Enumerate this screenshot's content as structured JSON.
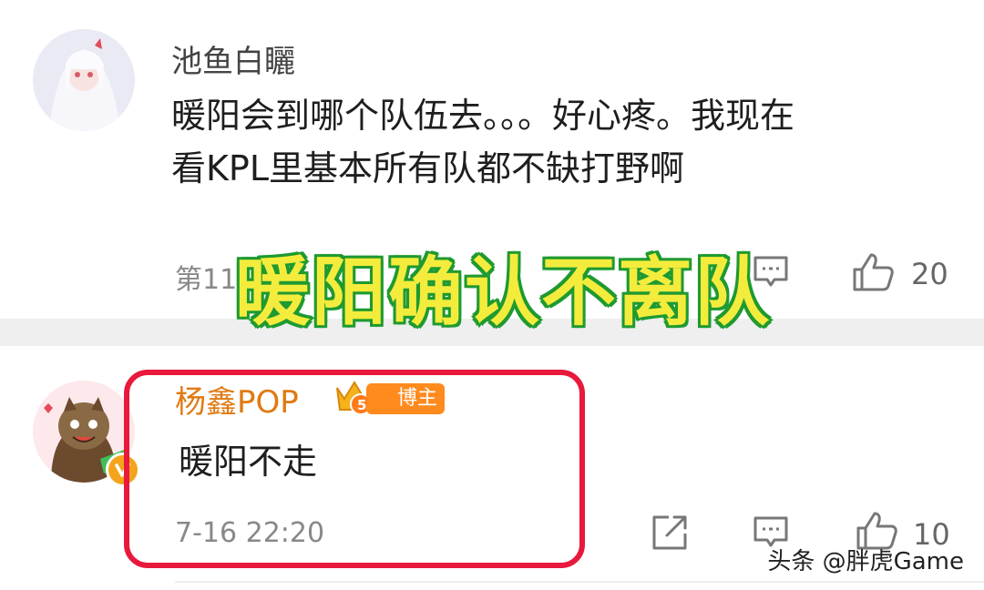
{
  "comments": [
    {
      "username": "池鱼白矖",
      "text_line1": "暖阳会到哪个队伍去。。。好心疼。我现在",
      "text_line2": "看KPL里基本所有队都不缺打野啊",
      "floor": "第11",
      "like_count": "20"
    },
    {
      "username": "杨鑫POP",
      "badge": "博主",
      "text": "暖阳不走",
      "timestamp": "7-16 22:20",
      "like_count": "10"
    }
  ],
  "overlay": {
    "title": "暖阳确认不离队"
  },
  "watermark": "头条 @胖虎Game",
  "colors": {
    "highlight": "#e8193c",
    "overlay_fill": "#f4ec3c",
    "overlay_stroke": "#1f9a31",
    "username2": "#e07a12"
  }
}
